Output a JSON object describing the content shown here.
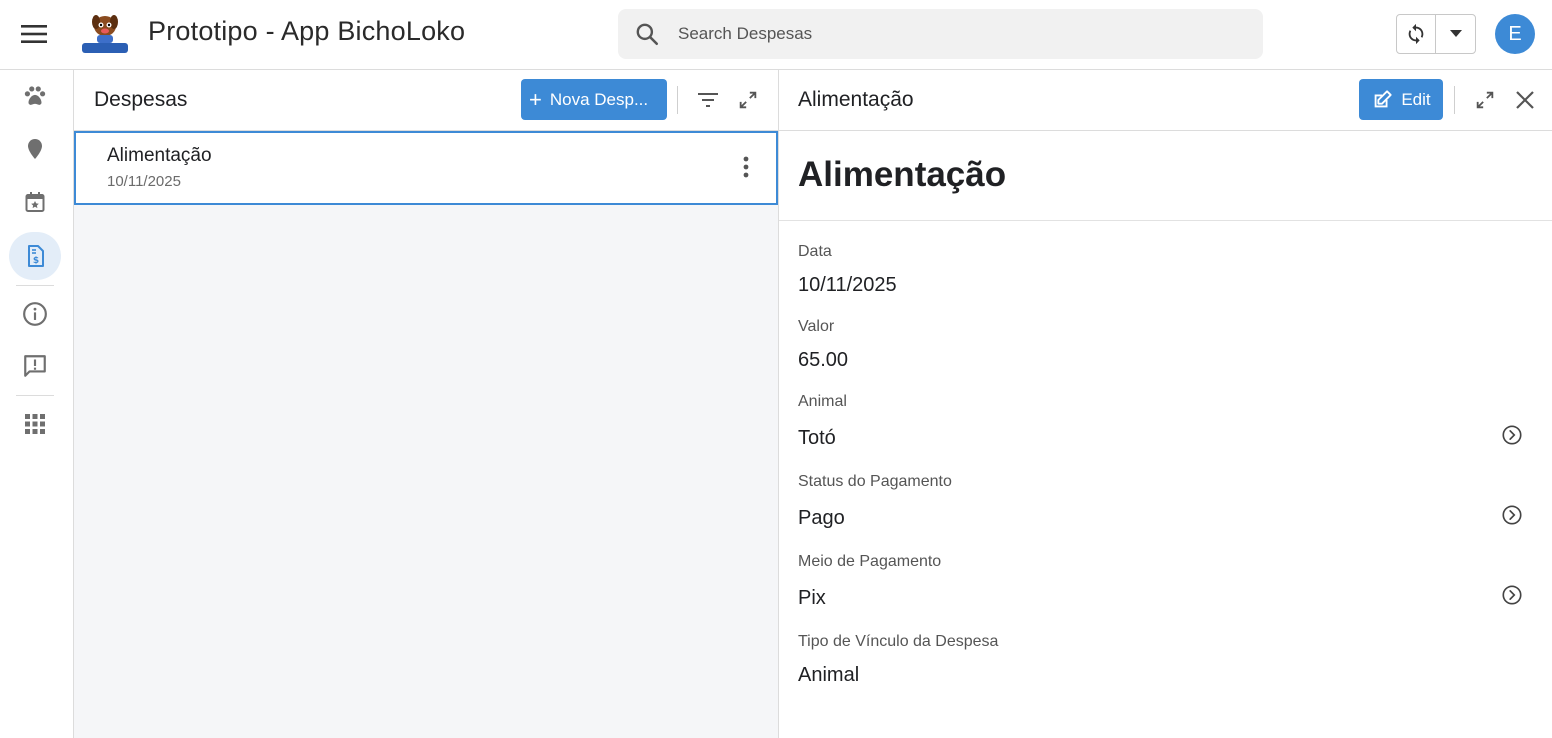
{
  "header": {
    "app_title": "Prototipo - App BichoLoko",
    "logo_text": "BichoLoko",
    "search_placeholder": "Search Despesas",
    "avatar_initial": "E",
    "accent_color": "#3d8ad6"
  },
  "rail": {
    "items": [
      {
        "icon": "paw-icon"
      },
      {
        "icon": "location-pin-icon"
      },
      {
        "icon": "calendar-star-icon"
      },
      {
        "icon": "invoice-dollar-icon",
        "active": true
      },
      {
        "icon": "info-icon"
      },
      {
        "icon": "feedback-icon"
      },
      {
        "icon": "apps-grid-icon"
      }
    ]
  },
  "list": {
    "title": "Despesas",
    "new_button_label": "Nova Desp...",
    "items": [
      {
        "title": "Alimentação",
        "date": "10/11/2025"
      }
    ]
  },
  "detail": {
    "header_title": "Alimentação",
    "edit_label": "Edit",
    "big_title": "Alimentação",
    "fields": [
      {
        "label": "Data",
        "value": "10/11/2025"
      },
      {
        "label": "Valor",
        "value": "65.00"
      },
      {
        "label": "Animal",
        "value": "Totó"
      },
      {
        "label": "Status do Pagamento",
        "value": "Pago"
      },
      {
        "label": "Meio de Pagamento",
        "value": "Pix"
      },
      {
        "label": "Tipo de Vínculo da Despesa",
        "value": "Animal"
      }
    ]
  }
}
